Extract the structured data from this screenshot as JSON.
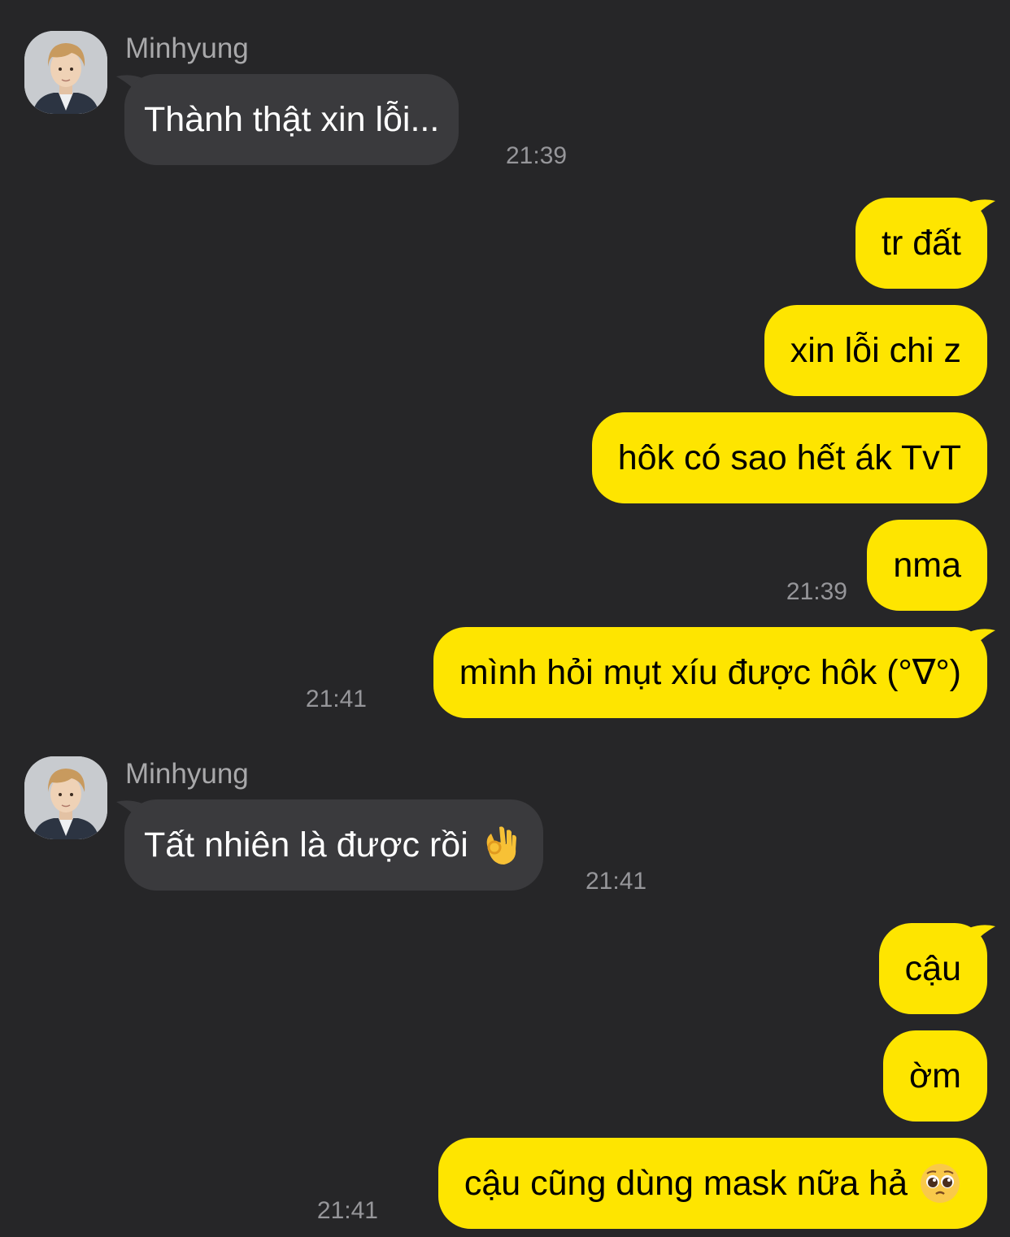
{
  "messages": [
    {
      "type": "incoming",
      "sender": "Minhyung",
      "text": "Thành thật xin lỗi...",
      "time": "21:39"
    },
    {
      "type": "outgoing",
      "text": "tr đất"
    },
    {
      "type": "outgoing",
      "text": "xin lỗi chi z"
    },
    {
      "type": "outgoing",
      "text": "hôk có sao hết ák TvT"
    },
    {
      "type": "outgoing",
      "text": "nma",
      "time": "21:39"
    },
    {
      "type": "outgoing",
      "text": "mình hỏi mụt xíu được hôk (°∇°)",
      "time": "21:41"
    },
    {
      "type": "incoming",
      "sender": "Minhyung",
      "text": "Tất nhiên là được rồi",
      "emoji": "ok-hand-emoji",
      "time": "21:41"
    },
    {
      "type": "outgoing",
      "text": "cậu"
    },
    {
      "type": "outgoing",
      "text": "ờm"
    },
    {
      "type": "outgoing",
      "text": "cậu cũng dùng mask nữa hả",
      "emoji": "pleading-face-emoji",
      "time": "21:41"
    }
  ],
  "colors": {
    "background": "#262628",
    "incoming_bubble": "#3a3a3d",
    "outgoing_bubble": "#fee500",
    "timestamp": "#96969a",
    "sender_name": "#a8a8aa"
  },
  "icons": {
    "avatar": "profile-photo-avatar",
    "ok_hand": "ok-hand-emoji",
    "pleading_face": "pleading-face-emoji"
  }
}
